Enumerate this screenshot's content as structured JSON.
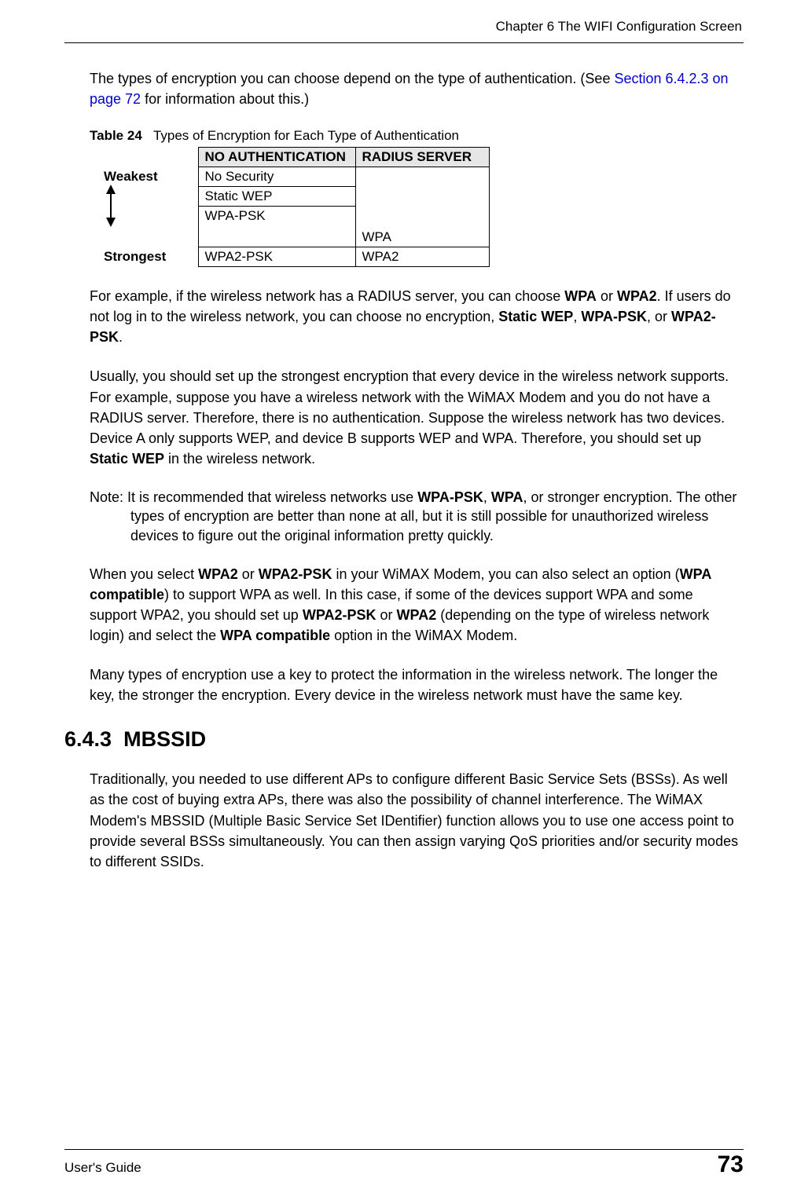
{
  "header": {
    "chapter": "Chapter 6 The WIFI Configuration Screen"
  },
  "intro": {
    "text_before_link": "The types of encryption you can choose depend on the type of authentication. (See ",
    "link_text": "Section 6.4.2.3 on page 72",
    "text_after_link": " for information about this.)"
  },
  "table": {
    "caption_label": "Table 24",
    "caption_text": "Types of Encryption for Each Type of Authentication",
    "headers": {
      "col0": "",
      "col1": "NO AUTHENTICATION",
      "col2": "RADIUS SERVER"
    },
    "rowlabels": {
      "weakest": "Weakest",
      "strongest": "Strongest"
    },
    "cells": {
      "r1_noauth": "No Security",
      "r2_noauth": "Static WEP",
      "r3_noauth": "WPA-PSK",
      "r3_radius": "WPA",
      "r4_noauth": "WPA2-PSK",
      "r4_radius": "WPA2"
    }
  },
  "para1": {
    "p1": "For example, if the wireless network has a RADIUS server, you can choose ",
    "b1": "WPA",
    "p2": " or ",
    "b2": "WPA2",
    "p3": ". If users do not log in to the wireless network, you can choose no encryption, ",
    "b3": "Static WEP",
    "p4": ", ",
    "b4": "WPA-PSK",
    "p5": ", or ",
    "b5": "WPA2-PSK",
    "p6": "."
  },
  "para2": {
    "p1": "Usually, you should set up the strongest encryption that every device in the wireless network supports. For example, suppose you have a wireless network with the WiMAX Modem and you do not have a RADIUS server. Therefore, there is no authentication. Suppose the wireless network has two devices. Device A only supports WEP, and device B supports WEP and WPA. Therefore, you should set up ",
    "b1": "Static WEP",
    "p2": " in the wireless network."
  },
  "note": {
    "label": "Note: ",
    "p1": "It is recommended that wireless networks use ",
    "b1": "WPA-PSK",
    "p2": ", ",
    "b2": "WPA",
    "p3": ", or stronger encryption. The other types of encryption are better than none at all, but it is still possible for unauthorized wireless devices to figure out the original information pretty quickly."
  },
  "para3": {
    "p1": "When you select ",
    "b1": "WPA2",
    "p2": " or ",
    "b2": "WPA2-PSK",
    "p3": " in your WiMAX Modem, you can also select an option (",
    "b3": "WPA compatible",
    "p4": ") to support WPA as well. In this case, if some of the devices support WPA and some support WPA2, you should set up ",
    "b4": "WPA2-PSK",
    "p5": " or ",
    "b5": "WPA2",
    "p6": " (depending on the type of wireless network login) and select the ",
    "b6": "WPA compatible",
    "p7": " option in the WiMAX Modem."
  },
  "para4": {
    "text": "Many types of encryption use a key to protect the information in the wireless network. The longer the key, the stronger the encryption. Every device in the wireless network must have the same key."
  },
  "section": {
    "number": "6.4.3",
    "title": "MBSSID"
  },
  "para5": {
    "text": "Traditionally, you needed to use different APs to configure different Basic Service Sets (BSSs). As well as the cost of buying extra APs, there was also the possibility of channel interference. The WiMAX Modem's MBSSID (Multiple Basic Service Set IDentifier) function allows you to use one access point to provide several BSSs simultaneously. You can then assign varying QoS priorities and/or security modes to different SSIDs."
  },
  "footer": {
    "guide": "User's Guide",
    "page": "73"
  }
}
